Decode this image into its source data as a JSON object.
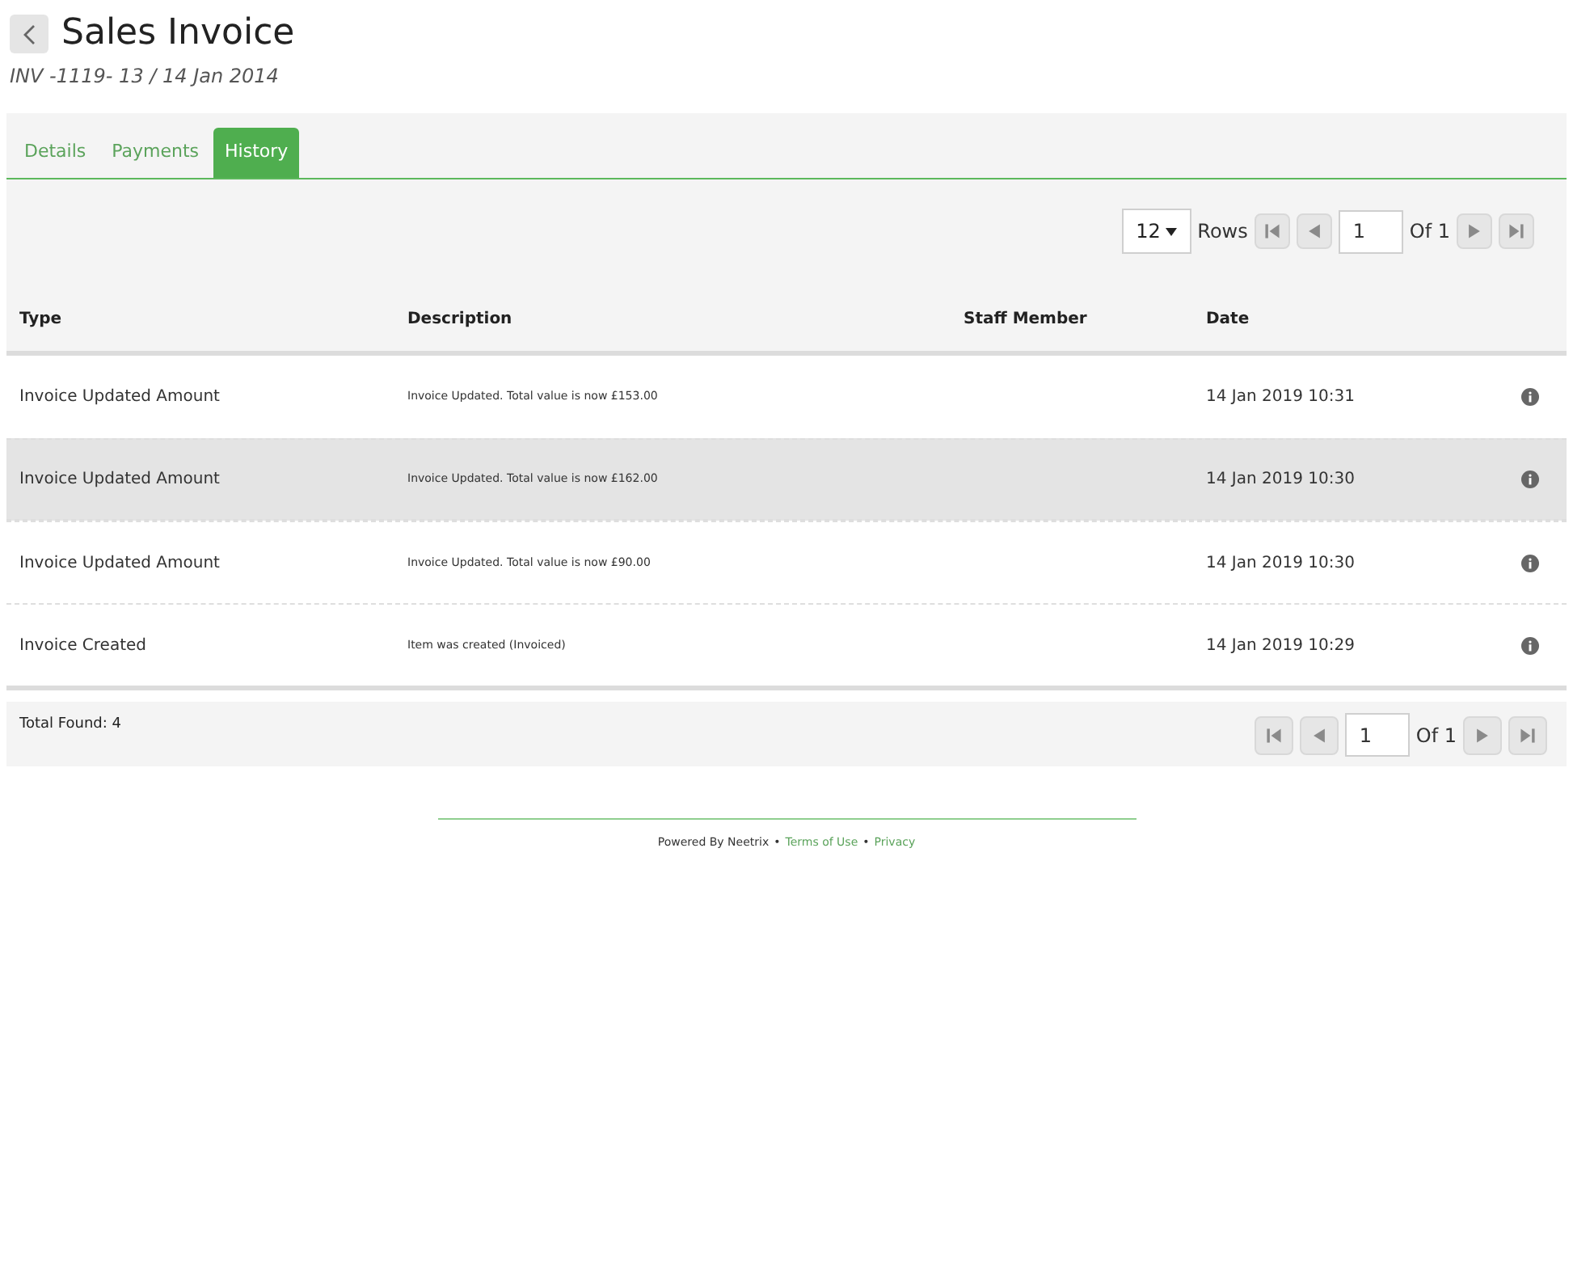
{
  "header": {
    "title": "Sales Invoice",
    "subtitle": "INV -1119- 13 / 14 Jan 2014"
  },
  "tabs": [
    {
      "label": "Details",
      "selected": false
    },
    {
      "label": "Payments",
      "selected": false
    },
    {
      "label": "History",
      "selected": true
    }
  ],
  "pager_top": {
    "rows_per_page": "12",
    "rows_label": "Rows",
    "page": "1",
    "of_label": "Of 1"
  },
  "table": {
    "columns": [
      "Type",
      "Description",
      "Staff Member",
      "Date"
    ],
    "rows": [
      {
        "type": "Invoice Updated Amount",
        "description": "Invoice Updated. Total value is now £153.00",
        "date": "14 Jan 2019 10:31",
        "selected": false
      },
      {
        "type": "Invoice Updated Amount",
        "description": "Invoice Updated. Total value is now £162.00",
        "date": "14 Jan 2019 10:30",
        "selected": true
      },
      {
        "type": "Invoice Updated Amount",
        "description": "Invoice Updated. Total value is now £90.00",
        "date": "14 Jan 2019 10:30",
        "selected": false
      },
      {
        "type": "Invoice Created",
        "description": "Item was created (Invoiced)",
        "date": "14 Jan 2019 10:29",
        "selected": false
      }
    ]
  },
  "summary": {
    "total": "Total Found: 4",
    "page": "1",
    "of_label": "Of 1"
  },
  "footer": {
    "credit": "Powered By Neetrix",
    "separator": "•",
    "links": [
      "Terms of Use",
      "Privacy"
    ]
  }
}
